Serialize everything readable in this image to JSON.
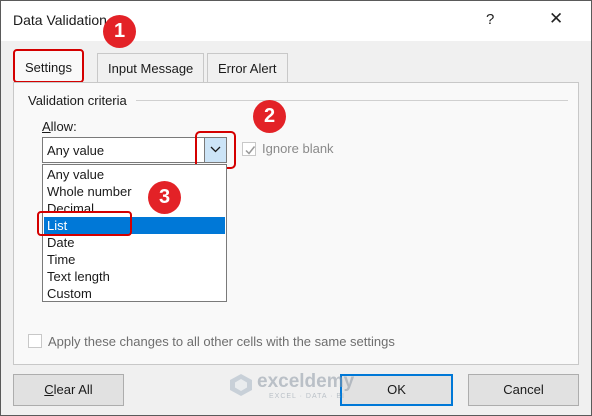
{
  "dialog": {
    "title": "Data Validation",
    "help_glyph": "?",
    "close_glyph": "✕"
  },
  "tabs": [
    {
      "label": "Settings",
      "active": true
    },
    {
      "label": "Input Message",
      "active": false
    },
    {
      "label": "Error Alert",
      "active": false
    }
  ],
  "settings": {
    "group_label": "Validation criteria",
    "allow_label_prefix": "",
    "allow_label_underlined": "A",
    "allow_label_rest": "llow:",
    "allow_value": "Any value",
    "ignore_blank_label": "Ignore blank",
    "ignore_blank_checked": true,
    "apply_label": "Apply these changes to all other cells with the same settings",
    "apply_checked": false
  },
  "allow_options": [
    "Any value",
    "Whole number",
    "Decimal",
    "List",
    "Date",
    "Time",
    "Text length",
    "Custom"
  ],
  "selected_option": "List",
  "buttons": {
    "clear_all_underlined": "C",
    "clear_all_rest": "lear All",
    "ok": "OK",
    "cancel": "Cancel"
  },
  "step_markers": [
    "1",
    "2",
    "3"
  ],
  "watermark": {
    "name": "exceldemy",
    "tagline": "EXCEL · DATA · BI"
  },
  "colors": {
    "accent": "#0078d7",
    "marker": "#e32227",
    "highlight": "#d40000"
  }
}
